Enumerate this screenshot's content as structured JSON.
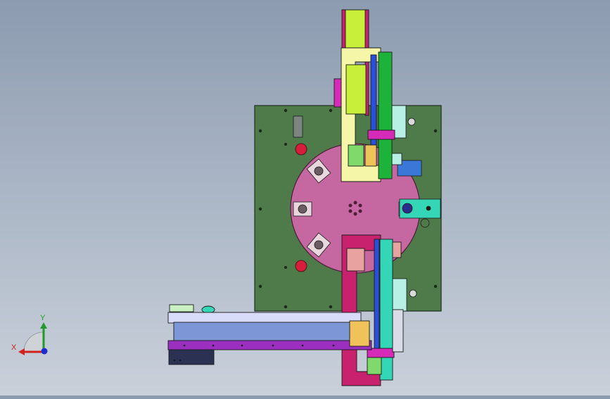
{
  "viewport": {
    "background_top": "#8c9bb0",
    "background_bottom": "#c9d0da"
  },
  "model": {
    "base_plate_color": "#4f7a4a",
    "turntable_color": "#c567a0",
    "top_frame_color": "#f6f6a8",
    "bottom_frame_color": "#c8226e",
    "conveyor_color": "#7d97d6",
    "conveyor_rail_color": "#9b2fc0",
    "accent_green": "#1db33a",
    "accent_cyan": "#35d6b6",
    "accent_lime": "#c8f03a",
    "accent_magenta": "#d62ab8",
    "accent_blue": "#2c4fd8"
  },
  "triad": {
    "x_label": "X",
    "y_label": "Y",
    "x_color": "#d0211c",
    "y_color": "#1f9a2a",
    "z_color": "#1d2bd0"
  }
}
